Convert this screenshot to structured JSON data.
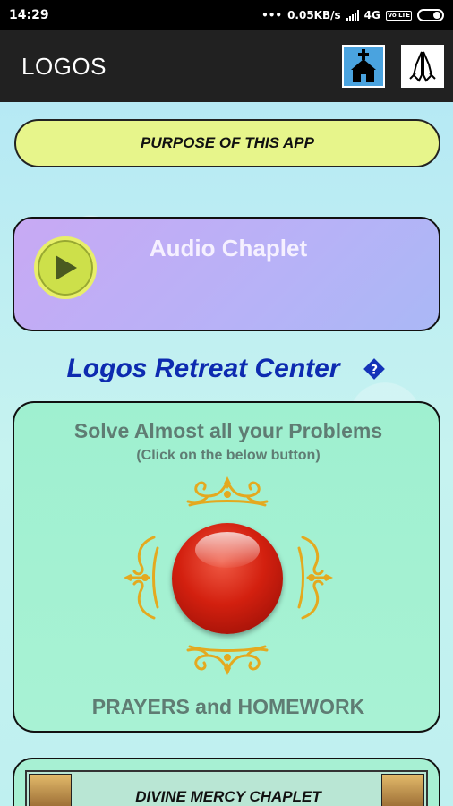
{
  "status_bar": {
    "time": "14:29",
    "network_speed": "0.05KB/s",
    "network_type": "4G",
    "volte": "Vo LTE"
  },
  "app_bar": {
    "title": "LOGOS",
    "actions": [
      {
        "icon": "church-icon"
      },
      {
        "icon": "praying-hands-icon"
      }
    ]
  },
  "main": {
    "purpose_label": "PURPOSE OF THIS APP",
    "audio": {
      "title": "Audio Chaplet",
      "play_icon": "play-icon"
    },
    "retreat_title": "Logos Retreat Center",
    "problems": {
      "title": "Solve Almost all your Problems",
      "subtitle": "(Click on the below button)",
      "footer": "PRAYERS and HOMEWORK"
    },
    "divine_mercy": {
      "title": "DIVINE MERCY CHAPLET"
    }
  },
  "colors": {
    "app_bar": "#212121",
    "purpose_bg": "#e7f58b",
    "audio_bg": "#b7b2f7",
    "retreat_text": "#0d2bb0",
    "problems_bg": "#a8f2d4",
    "red_button": "#d3200f",
    "ornament": "#e4a91f"
  }
}
